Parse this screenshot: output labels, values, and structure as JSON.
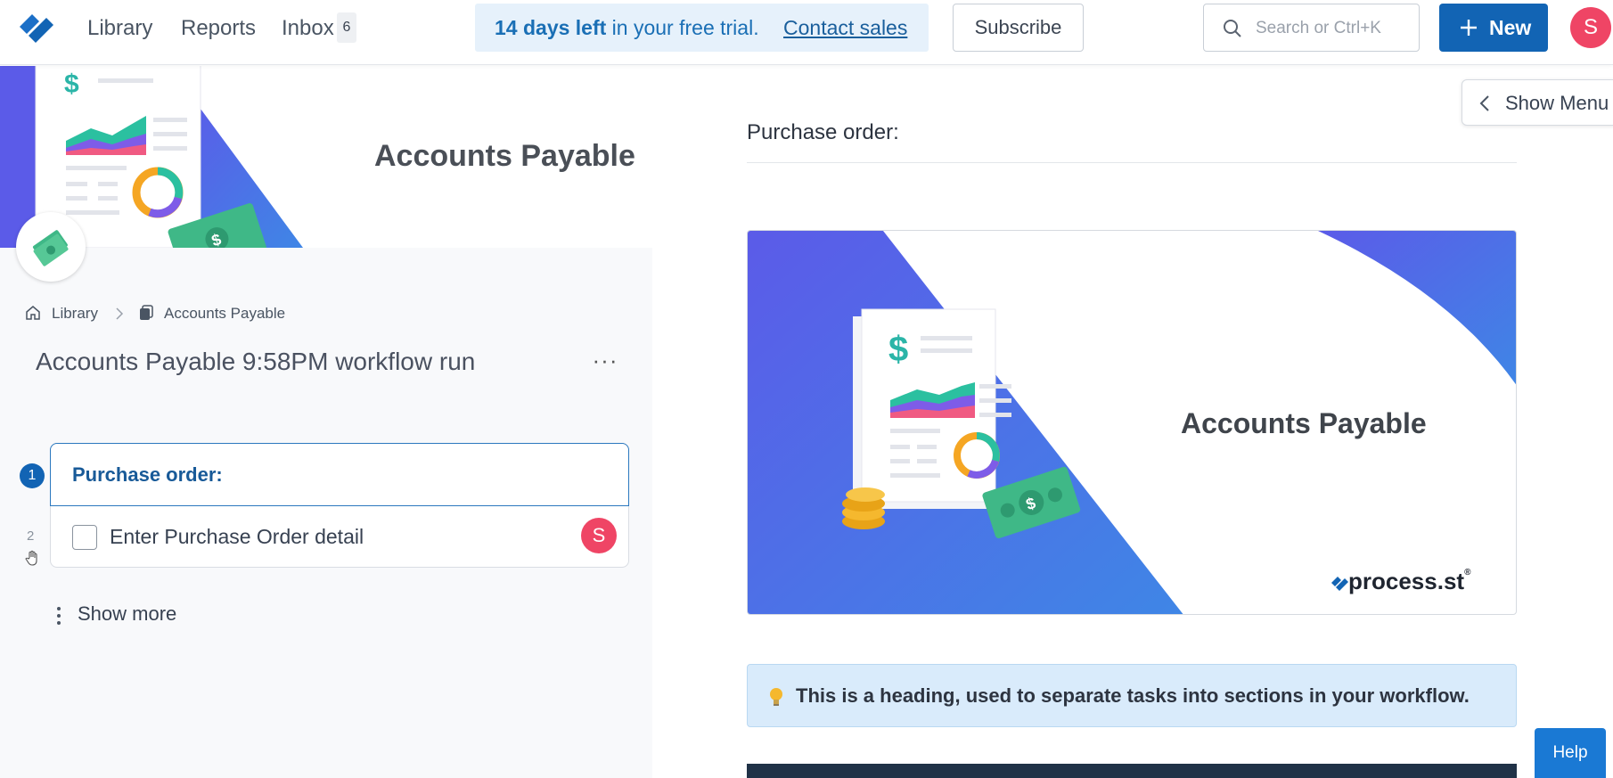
{
  "topbar": {
    "nav": {
      "library": "Library",
      "reports": "Reports",
      "inbox": "Inbox",
      "inbox_count": "6"
    },
    "trial": {
      "days": "14 days left",
      "rest": " in your free trial.",
      "contact": "Contact sales"
    },
    "subscribe_label": "Subscribe",
    "search_placeholder": "Search or Ctrl+K",
    "new_label": "New",
    "user_initial": "S"
  },
  "banner": {
    "title": "Accounts Payable"
  },
  "breadcrumb": {
    "home": "Library",
    "current": "Accounts Payable"
  },
  "run": {
    "title": "Accounts Payable 9:58PM workflow run",
    "menu": "···"
  },
  "steps": [
    {
      "number": "1",
      "label": "Purchase order:",
      "type": "heading"
    },
    {
      "number": "2",
      "label": "Enter Purchase Order detail",
      "type": "task",
      "assignee": "S"
    }
  ],
  "show_more": "Show more",
  "content": {
    "heading": "Purchase order:",
    "hero_title": "Accounts Payable",
    "brand": "process.st",
    "brand_tm": "®",
    "callout": "This is a heading, used to separate tasks into sections in your workflow."
  },
  "show_menu": "Show Menu",
  "help": "Help",
  "colors": {
    "primary": "#1264b4",
    "avatar": "#ef4565",
    "callout_bg": "#d9ebfb",
    "trial_bg": "#e6f1fb",
    "hero_gradient": [
      "#5b5be8",
      "#3f86e6"
    ]
  }
}
